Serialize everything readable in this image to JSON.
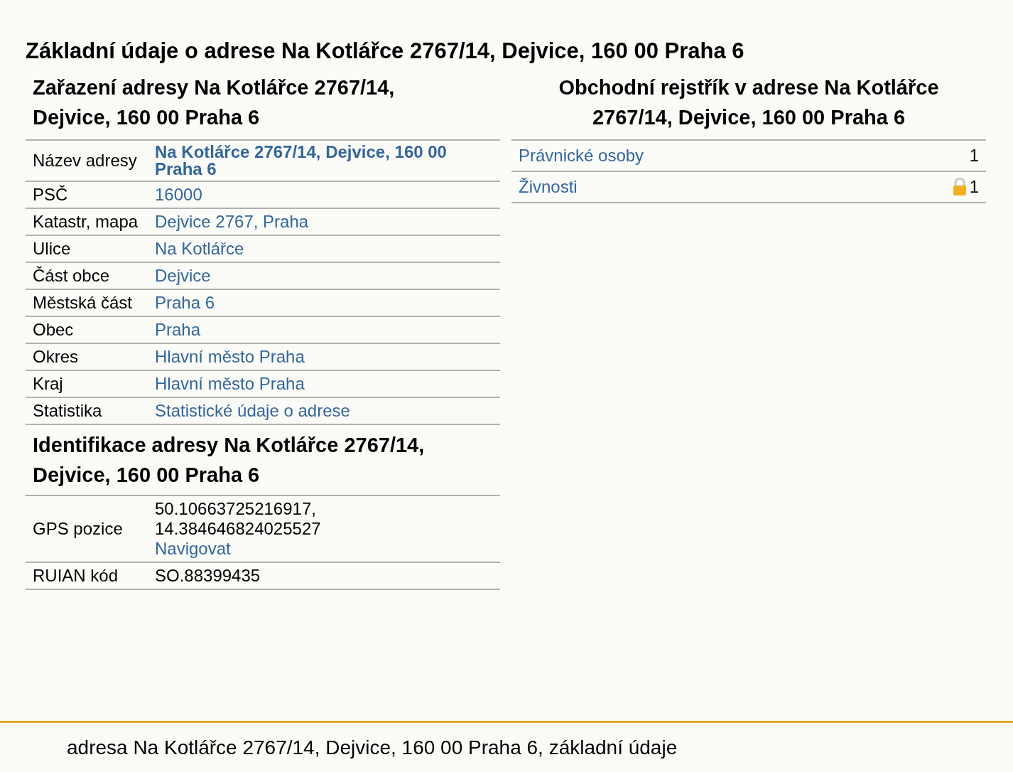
{
  "page_title": "Základní údaje o adrese Na Kotlářce 2767/14, Dejvice, 160 00 Praha 6",
  "classification": {
    "title": "Zařazení adresy Na Kotlářce 2767/14, Dejvice, 160 00 Praha 6",
    "rows": [
      {
        "label": "Název adresy",
        "lines": [
          {
            "text": "Na Kotlářce 2767/14, Dejvice, 160 00 Praha 6",
            "kind": "strong_link"
          }
        ]
      },
      {
        "label": "PSČ",
        "lines": [
          {
            "text": "16000",
            "kind": "link"
          }
        ]
      },
      {
        "label": "Katastr, mapa",
        "lines": [
          {
            "text": "Dejvice 2767, Praha",
            "kind": "link"
          }
        ]
      },
      {
        "label": "Ulice",
        "lines": [
          {
            "text": "Na Kotlářce",
            "kind": "link"
          }
        ]
      },
      {
        "label": "Část obce",
        "lines": [
          {
            "text": "Dejvice",
            "kind": "link"
          }
        ]
      },
      {
        "label": "Městská část",
        "lines": [
          {
            "text": "Praha 6",
            "kind": "link"
          }
        ]
      },
      {
        "label": "Obec",
        "lines": [
          {
            "text": "Praha",
            "kind": "link"
          }
        ]
      },
      {
        "label": "Okres",
        "lines": [
          {
            "text": "Hlavní město Praha",
            "kind": "link"
          }
        ]
      },
      {
        "label": "Kraj",
        "lines": [
          {
            "text": "Hlavní město Praha",
            "kind": "link"
          }
        ]
      },
      {
        "label": "Statistika",
        "lines": [
          {
            "text": "Statistické údaje o adrese",
            "kind": "link"
          }
        ]
      }
    ]
  },
  "identification": {
    "title": "Identifikace adresy Na Kotlářce 2767/14, Dejvice, 160 00 Praha 6",
    "rows": [
      {
        "label": "GPS pozice",
        "lines": [
          {
            "text": "50.10663725216917,",
            "kind": "text"
          },
          {
            "text": "14.384646824025527",
            "kind": "text"
          },
          {
            "text": "Navigovat",
            "kind": "link"
          }
        ]
      },
      {
        "label": "RUIAN kód",
        "lines": [
          {
            "text": "SO.88399435",
            "kind": "text"
          }
        ]
      }
    ]
  },
  "business_register": {
    "title": "Obchodní rejstřík v adrese Na Kotlářce 2767/14, Dejvice, 160 00 Praha 6",
    "rows": [
      {
        "label": "Právnické osoby",
        "count": "1",
        "locked": false
      },
      {
        "label": "Živnosti",
        "count": "1",
        "locked": true
      }
    ]
  },
  "footer": "adresa Na Kotlářce 2767/14, Dejvice, 160 00 Praha 6, základní údaje"
}
